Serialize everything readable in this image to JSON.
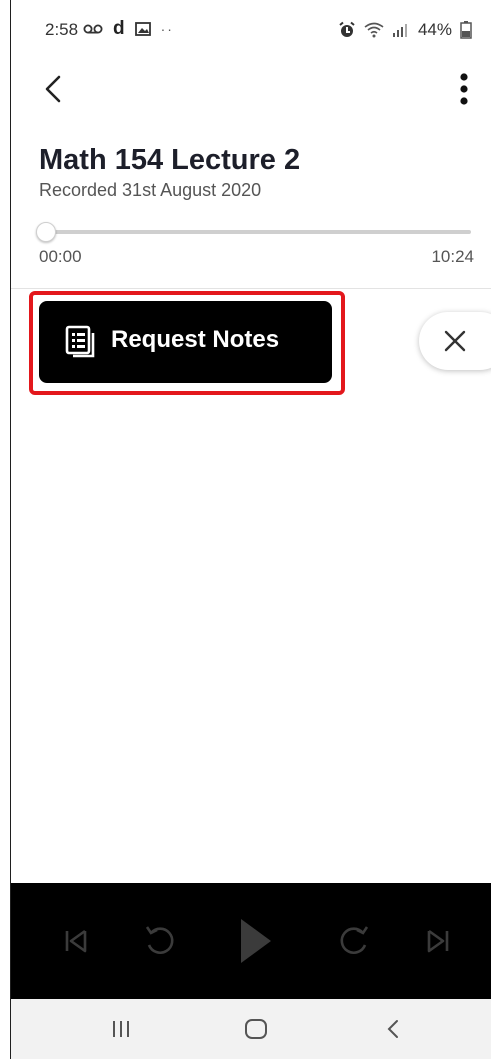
{
  "status_bar": {
    "time": "2:58",
    "battery": "44%",
    "icons_left": [
      "voicemail-icon",
      "d-app-icon",
      "image-icon",
      "more-dots-icon"
    ],
    "icons_right": [
      "alarm-icon",
      "wifi-icon",
      "signal-icon",
      "battery-icon"
    ]
  },
  "header": {
    "title": "Math 154 Lecture 2",
    "subtitle": "Recorded 31st August 2020"
  },
  "playback": {
    "current_time": "00:00",
    "total_time": "10:24",
    "progress": 0
  },
  "actions": {
    "request_notes_label": "Request Notes"
  },
  "player_controls": [
    "skip-back-icon",
    "rewind-icon",
    "play-icon",
    "forward-icon",
    "skip-forward-icon"
  ],
  "nav_bar": [
    "recents-icon",
    "home-icon",
    "back-icon"
  ],
  "colors": {
    "highlight": "#e3171c",
    "button_bg": "#000000",
    "player_bg": "#000000",
    "control_disabled": "#3b3b3b"
  }
}
